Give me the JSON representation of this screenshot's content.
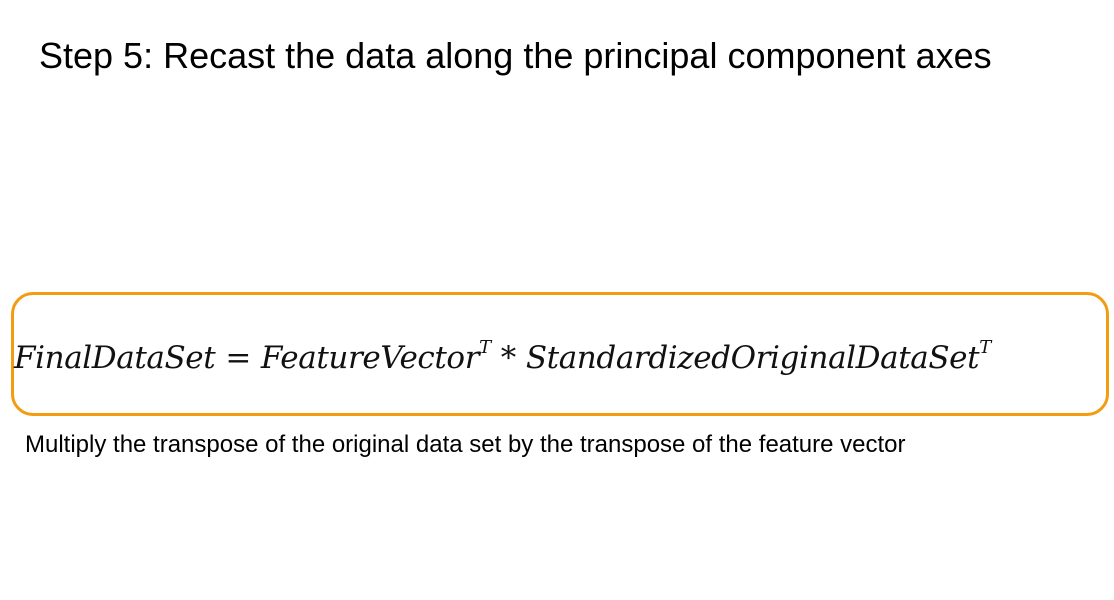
{
  "slide": {
    "title": "Step 5: Recast the data along the principal component axes",
    "caption": "Multiply the transpose of the original data set by the transpose of the feature vector",
    "accent_color": "#f39c12"
  },
  "formula": {
    "lhs": "FinalDataSet",
    "equals": "=",
    "term1": "FeatureVector",
    "term1_sup": "T",
    "operator": "*",
    "term2": "StandardizedOriginalDataSet",
    "term2_sup": "T"
  }
}
